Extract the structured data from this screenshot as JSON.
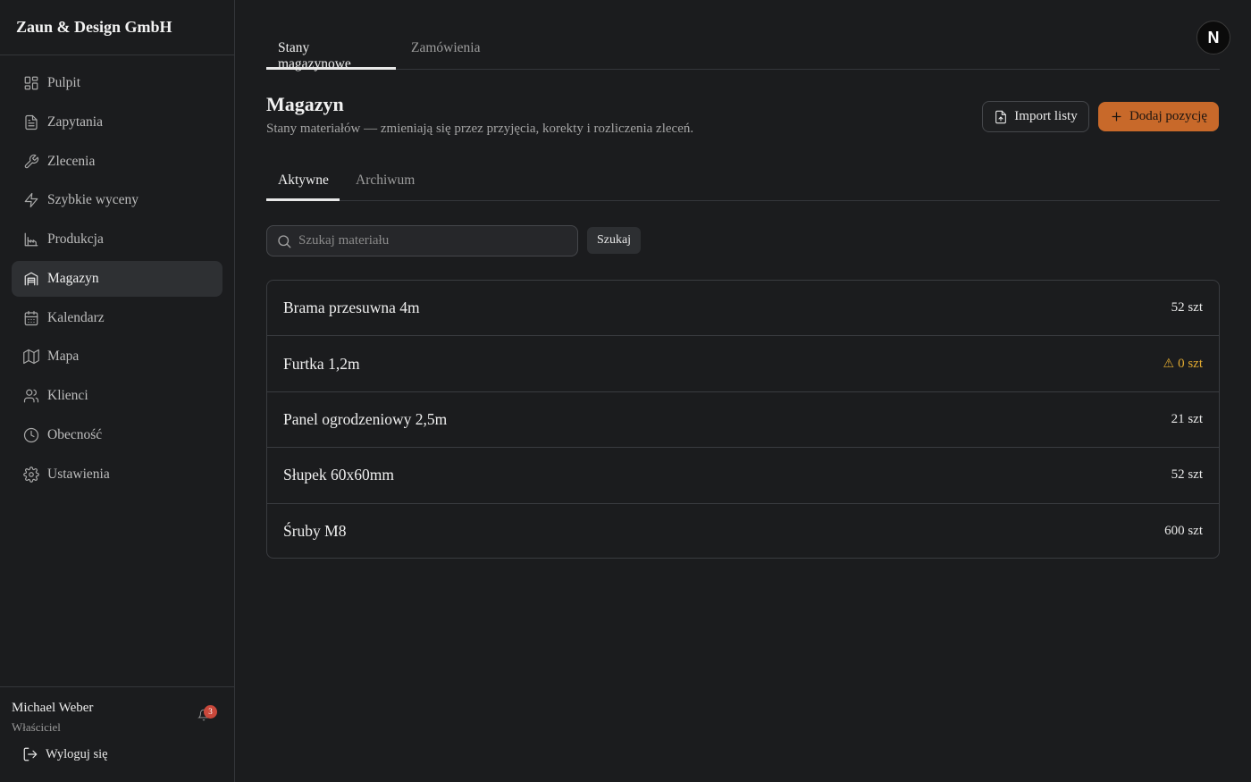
{
  "brand": "Zaun & Design GmbH",
  "sidebar": {
    "items": [
      {
        "label": "Pulpit",
        "icon": "dashboard-icon",
        "active": false
      },
      {
        "label": "Zapytania",
        "icon": "document-icon",
        "active": false
      },
      {
        "label": "Zlecenia",
        "icon": "wrench-icon",
        "active": false
      },
      {
        "label": "Szybkie wyceny",
        "icon": "lightning-icon",
        "active": false
      },
      {
        "label": "Produkcja",
        "icon": "factory-icon",
        "active": false
      },
      {
        "label": "Magazyn",
        "icon": "warehouse-icon",
        "active": true
      },
      {
        "label": "Kalendarz",
        "icon": "calendar-icon",
        "active": false
      },
      {
        "label": "Mapa",
        "icon": "map-icon",
        "active": false
      },
      {
        "label": "Klienci",
        "icon": "users-icon",
        "active": false
      },
      {
        "label": "Obecność",
        "icon": "clock-icon",
        "active": false
      },
      {
        "label": "Ustawienia",
        "icon": "gear-icon",
        "active": false
      }
    ]
  },
  "user": {
    "name": "Michael Weber",
    "role": "Właściciel",
    "notifications": "3",
    "logout_label": "Wyloguj się"
  },
  "header": {
    "tabs": [
      {
        "label": "Stany magazynowe",
        "active": true
      },
      {
        "label": "Zamówienia",
        "active": false
      }
    ],
    "avatar_letter": "N"
  },
  "page": {
    "title": "Magazyn",
    "subtitle": "Stany materiałów — zmieniają się przez przyjęcia, korekty i rozliczenia zleceń.",
    "import_label": "Import listy",
    "add_label": "Dodaj pozycję"
  },
  "subtabs": [
    {
      "label": "Aktywne",
      "active": true
    },
    {
      "label": "Archiwum",
      "active": false
    }
  ],
  "search": {
    "placeholder": "Szukaj materiału",
    "button_label": "Szukaj"
  },
  "items": [
    {
      "name": "Brama przesuwna 4m",
      "qty": "52 szt",
      "warning": false
    },
    {
      "name": "Furtka 1,2m",
      "qty": "0 szt",
      "warning": true
    },
    {
      "name": "Panel ogrodzeniowy 2,5m",
      "qty": "21 szt",
      "warning": false
    },
    {
      "name": "Słupek 60x60mm",
      "qty": "52 szt",
      "warning": false
    },
    {
      "name": "Śruby M8",
      "qty": "600 szt",
      "warning": false
    }
  ],
  "colors": {
    "accent": "#c8692a",
    "warning": "#e0a930",
    "badge": "#c9483b",
    "background": "#1b1c1e"
  }
}
